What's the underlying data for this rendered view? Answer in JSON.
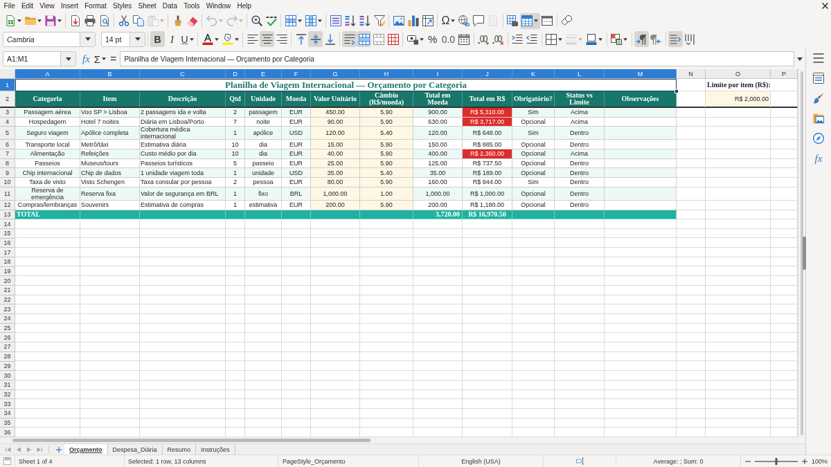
{
  "menu_bar": [
    "File",
    "Edit",
    "View",
    "Insert",
    "Format",
    "Styles",
    "Sheet",
    "Data",
    "Tools",
    "Window",
    "Help"
  ],
  "standard_toolbar": {
    "paste": {
      "disabled": true
    },
    "undo": {
      "disabled": true
    },
    "redo": {
      "disabled": true
    },
    "special_character": {
      "label": "Ω"
    },
    "headers_footers": {
      "disabled": true
    },
    "freeze_rows_columns": {
      "on": true
    }
  },
  "formatting_toolbar": {
    "font_name": "Cambria",
    "font_size": "14 pt",
    "bold": {
      "label": "B",
      "on": true
    },
    "italic": {
      "label": "I",
      "on": false
    },
    "underline": {
      "label": "U",
      "on": false
    },
    "align_left": {
      "on": false
    },
    "align_center": {
      "on": true
    },
    "align_right": {
      "on": false
    },
    "align_top": {
      "on": false
    },
    "align_middle": {
      "on": true
    },
    "align_bottom": {
      "on": false
    },
    "wrap_text": {
      "on": true
    },
    "merge_and_center": {
      "on": true
    },
    "percent": {
      "label": "%"
    },
    "number_format": {
      "label": "0.0"
    },
    "border_style": {
      "disabled": true
    },
    "left_to_right": {
      "on": true
    },
    "right_to_left": {
      "on": false
    },
    "text_horizontal": {
      "on": true
    },
    "text_vertical": {
      "on": false
    }
  },
  "formula_bar": {
    "name_box": "A1:M1",
    "function_wizard": "fx",
    "sum": "Σ",
    "equals": "=",
    "formula": "Planilha de Viagem Internacional — Orçamento por Categoria"
  },
  "sheet": {
    "columns": [
      {
        "label": "A",
        "selected": true
      },
      {
        "label": "B",
        "selected": true
      },
      {
        "label": "C",
        "selected": true
      },
      {
        "label": "D",
        "selected": true
      },
      {
        "label": "E",
        "selected": true
      },
      {
        "label": "F",
        "selected": true
      },
      {
        "label": "G",
        "selected": true
      },
      {
        "label": "H",
        "selected": true
      },
      {
        "label": "I",
        "selected": true
      },
      {
        "label": "J",
        "selected": true
      },
      {
        "label": "K",
        "selected": true
      },
      {
        "label": "L",
        "selected": true
      },
      {
        "label": "M",
        "selected": true
      },
      {
        "label": "N",
        "selected": false
      },
      {
        "label": "O",
        "selected": false
      },
      {
        "label": "P",
        "selected": false
      }
    ],
    "rows": [
      {
        "label": "1",
        "selected": true
      },
      {
        "label": "2",
        "selected": false
      },
      {
        "label": "3",
        "selected": false
      },
      {
        "label": "4",
        "selected": false
      },
      {
        "label": "5",
        "selected": false
      },
      {
        "label": "6",
        "selected": false
      },
      {
        "label": "7",
        "selected": false
      },
      {
        "label": "8",
        "selected": false
      },
      {
        "label": "9",
        "selected": false
      },
      {
        "label": "10",
        "selected": false
      },
      {
        "label": "11",
        "selected": false
      },
      {
        "label": "12",
        "selected": false
      },
      {
        "label": "13",
        "selected": false
      },
      {
        "label": "14",
        "selected": false
      },
      {
        "label": "15",
        "selected": false
      },
      {
        "label": "16",
        "selected": false
      },
      {
        "label": "17",
        "selected": false
      },
      {
        "label": "18",
        "selected": false
      },
      {
        "label": "19",
        "selected": false
      },
      {
        "label": "20",
        "selected": false
      },
      {
        "label": "21",
        "selected": false
      },
      {
        "label": "22",
        "selected": false
      },
      {
        "label": "23",
        "selected": false
      },
      {
        "label": "24",
        "selected": false
      },
      {
        "label": "25",
        "selected": false
      },
      {
        "label": "26",
        "selected": false
      },
      {
        "label": "27",
        "selected": false
      },
      {
        "label": "28",
        "selected": false
      },
      {
        "label": "29",
        "selected": false
      },
      {
        "label": "30",
        "selected": false
      },
      {
        "label": "31",
        "selected": false
      },
      {
        "label": "32",
        "selected": false
      },
      {
        "label": "33",
        "selected": false
      },
      {
        "label": "34",
        "selected": false
      },
      {
        "label": "35",
        "selected": false
      },
      {
        "label": "36",
        "selected": false
      }
    ],
    "title": {
      "text": "Planilha de Viagem Internacional — Orçamento por Categoria",
      "selected": true
    },
    "limit": {
      "label": "Limite por item (R$):",
      "value": "R$ 2,000.00"
    },
    "table": {
      "headers": [
        "Categoria",
        "Item",
        "Descrição",
        "Qtd",
        "Unidade",
        "Moeda",
        "Valor Unitário",
        "Câmbio (R$/moeda)",
        "Total em Moeda",
        "Total em R$",
        "Obrigatório?",
        "Status vs Limite",
        "Observações"
      ],
      "rows": [
        {
          "category": "Passagem aérea",
          "item": "Voo SP > Lisboa",
          "description": "2 passagens ida e volta",
          "qty": "2",
          "unit": "passagem",
          "currency": "EUR",
          "unit_value": "450.00",
          "exchange_rate": "5.90",
          "total_currency": "900.00",
          "total_brl": "R$ 5,310.00",
          "required": "Sim",
          "status": "Acima",
          "over_limit": true
        },
        {
          "category": "Hospedagem",
          "item": "Hotel 7 noites",
          "description": "Diária em Lisboa/Porto",
          "qty": "7",
          "unit": "noite",
          "currency": "EUR",
          "unit_value": "90.00",
          "exchange_rate": "5.90",
          "total_currency": "630.00",
          "total_brl": "R$ 3,717.00",
          "required": "Opcional",
          "status": "Acima",
          "over_limit": true
        },
        {
          "category": "Seguro viagem",
          "item": "Apólice completa",
          "description": "Cobertura médica internacional",
          "qty": "1",
          "unit": "apólice",
          "currency": "USD",
          "unit_value": "120.00",
          "exchange_rate": "5.40",
          "total_currency": "120.00",
          "total_brl": "R$ 648.00",
          "required": "Sim",
          "status": "Dentro",
          "over_limit": false
        },
        {
          "category": "Transporte local",
          "item": "Metrô/táxi",
          "description": "Estimativa diária",
          "qty": "10",
          "unit": "dia",
          "currency": "EUR",
          "unit_value": "15.00",
          "exchange_rate": "5.90",
          "total_currency": "150.00",
          "total_brl": "R$ 885.00",
          "required": "Opcional",
          "status": "Dentro",
          "over_limit": false
        },
        {
          "category": "Alimentação",
          "item": "Refeições",
          "description": "Custo médio por dia",
          "qty": "10",
          "unit": "dia",
          "currency": "EUR",
          "unit_value": "40.00",
          "exchange_rate": "5.90",
          "total_currency": "400.00",
          "total_brl": "R$ 2,360.00",
          "required": "Opcional",
          "status": "Acima",
          "over_limit": true
        },
        {
          "category": "Passeios",
          "item": "Museus/tours",
          "description": "Passeios turísticos",
          "qty": "5",
          "unit": "passeio",
          "currency": "EUR",
          "unit_value": "25.00",
          "exchange_rate": "5.90",
          "total_currency": "125.00",
          "total_brl": "R$ 737.50",
          "required": "Opcional",
          "status": "Dentro",
          "over_limit": false
        },
        {
          "category": "Chip internacional",
          "item": "Chip de dados",
          "description": "1 unidade viagem toda",
          "qty": "1",
          "unit": "unidade",
          "currency": "USD",
          "unit_value": "35.00",
          "exchange_rate": "5.40",
          "total_currency": "35.00",
          "total_brl": "R$ 189.00",
          "required": "Opcional",
          "status": "Dentro",
          "over_limit": false
        },
        {
          "category": "Taxa de visto",
          "item": "Visto Schengen",
          "description": "Taxa consular por pessoa",
          "qty": "2",
          "unit": "pessoa",
          "currency": "EUR",
          "unit_value": "80.00",
          "exchange_rate": "5.90",
          "total_currency": "160.00",
          "total_brl": "R$ 944.00",
          "required": "Sim",
          "status": "Dentro",
          "over_limit": false
        },
        {
          "category": "Reserva de emergência",
          "item": "Reserva fixa",
          "description": "Valor de segurança em BRL",
          "qty": "1",
          "unit": "fixo",
          "currency": "BRL",
          "unit_value": "1,000.00",
          "exchange_rate": "1.00",
          "total_currency": "1,000.00",
          "total_brl": "R$ 1,000.00",
          "required": "Opcional",
          "status": "Dentro",
          "over_limit": false
        },
        {
          "category": "Compras/lembranças",
          "item": "Souvenirs",
          "description": "Estimativa de compras",
          "qty": "1",
          "unit": "estimativa",
          "currency": "EUR",
          "unit_value": "200.00",
          "exchange_rate": "5.90",
          "total_currency": "200.00",
          "total_brl": "R$ 1,180.00",
          "required": "Opcional",
          "status": "Dentro",
          "over_limit": false
        }
      ],
      "total": {
        "label": "TOTAL",
        "total_currency": "3,720.00",
        "total_brl": "R$ 16,970.50"
      }
    }
  },
  "sheet_tabs": [
    {
      "label": "Orçamento",
      "selected": true
    },
    {
      "label": "Despesa_Diária",
      "selected": false
    },
    {
      "label": "Resumo",
      "selected": false
    },
    {
      "label": "Instruções",
      "selected": false
    }
  ],
  "sidebar": {
    "functions": "fx"
  },
  "status_bar": {
    "sheet": "Sheet 1 of 4",
    "selection": "Selected: 1 row, 13 columns",
    "page_style": "PageStyle_Orçamento",
    "language": "English (USA)",
    "summary": "Average: ; Sum: 0",
    "zoom": {
      "level": 0.5,
      "reading": "100%"
    }
  }
}
